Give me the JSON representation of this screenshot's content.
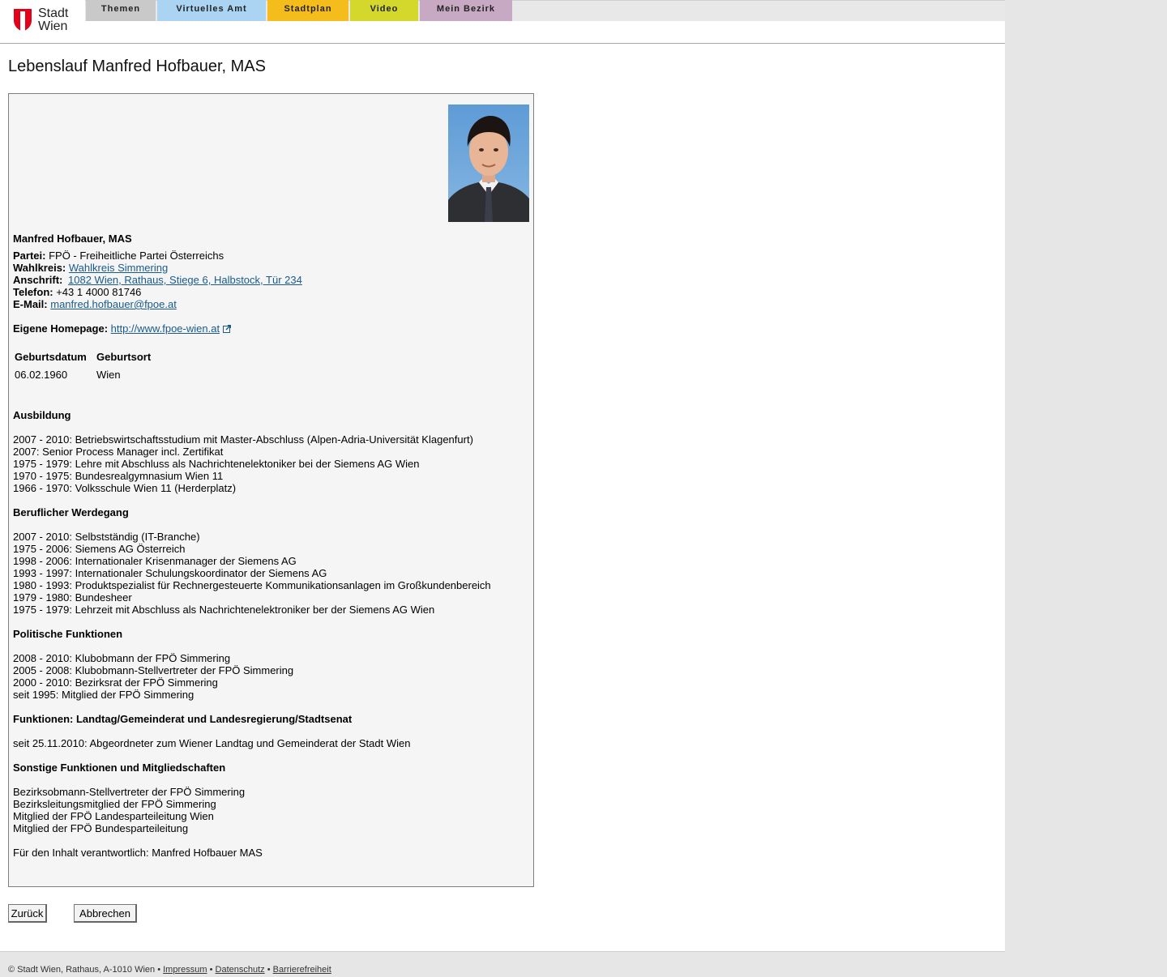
{
  "header": {
    "logo_text": "Stadt\nWien",
    "nav": [
      {
        "label": "Themen",
        "color": "#c9c9c9"
      },
      {
        "label": "Virtuelles Amt",
        "color": "#aad4f2"
      },
      {
        "label": "Stadtplan",
        "color": "#f5bd1c"
      },
      {
        "label": "Video",
        "color": "#d4d82c"
      },
      {
        "label": "Mein Bezirk",
        "color": "#c8a9c4"
      }
    ]
  },
  "page_title": "Lebenslauf Manfred Hofbauer, MAS",
  "profile": {
    "name": "Manfred Hofbauer, MAS",
    "partei_label": "Partei:",
    "partei": "FPÖ - Freiheitliche Partei Österreichs",
    "wahlkreis_label": "Wahlkreis:",
    "wahlkreis": "Wahlkreis Simmering",
    "anschrift_label": "Anschrift:",
    "anschrift": "1082 Wien, Rathaus, Stiege 6, Halbstock, Tür 234",
    "telefon_label": "Telefon:",
    "telefon": "+43 1 4000 81746",
    "email_label": "E-Mail:",
    "email": "manfred.hofbauer@fpoe.at",
    "homepage_label": "Eigene Homepage:",
    "homepage": "http://www.fpoe-wien.at",
    "table": {
      "headers": [
        "Geburtsdatum",
        "Geburtsort"
      ],
      "values": [
        "06.02.1960",
        "Wien"
      ]
    }
  },
  "sections": [
    {
      "heading": "Ausbildung",
      "lines": [
        "2007 - 2010: Betriebswirtschaftsstudium mit Master-Abschluss (Alpen-Adria-Universität Klagenfurt)",
        "2007: Senior Process Manager incl. Zertifikat",
        "1975 - 1979: Lehre mit Abschluss als Nachrichtenelektoniker bei der Siemens AG Wien",
        "1970 - 1975: Bundesrealgymnasium Wien 11",
        "1966 - 1970: Volksschule Wien 11 (Herderplatz)"
      ]
    },
    {
      "heading": "Beruflicher Werdegang",
      "lines": [
        "2007 - 2010: Selbstständig (IT-Branche)",
        "1975 - 2006: Siemens AG Österreich",
        "1998 - 2006: Internationaler Krisenmanager der Siemens AG",
        "1993 - 1997: Internationaler Schulungskoordinator der Siemens AG",
        "1980 - 1993: Produktspezialist für Rechnergesteuerte Kommunikationsanlagen im Großkundenbereich",
        "1979 - 1980: Bundesheer",
        "1975 - 1979: Lehrzeit mit Abschluss als Nachrichtenelektroniker ber der Siemens AG Wien"
      ]
    },
    {
      "heading": "Politische Funktionen",
      "lines": [
        "2008 - 2010: Klubobmann der FPÖ Simmering",
        "2005 - 2008: Klubobmann-Stellvertreter der FPÖ Simmering",
        "2000 - 2010: Bezirksrat der FPÖ Simmering",
        "seit 1995: Mitglied der FPÖ Simmering"
      ]
    },
    {
      "heading": "Funktionen: Landtag/Gemeinderat und Landesregierung/Stadtsenat",
      "lines": [
        "seit 25.11.2010: Abgeordneter zum Wiener Landtag und Gemeinderat der Stadt Wien"
      ]
    },
    {
      "heading": "Sonstige Funktionen und Mitgliedschaften",
      "lines": [
        "Bezirksobmann-Stellvertreter der FPÖ Simmering",
        "Bezirksleitungsmitglied der FPÖ Simmering",
        "Mitglied der FPÖ Landesparteileitung Wien",
        "Mitglied der FPÖ Bundesparteileitung"
      ]
    }
  ],
  "responsible": "Für den Inhalt verantwortlich: Manfred Hofbauer MAS",
  "buttons": {
    "back": "Zurück",
    "cancel": "Abbrechen"
  },
  "footer": {
    "copyright": "© Stadt Wien, Rathaus, A-1010 Wien",
    "sep": "•",
    "links": [
      "Impressum",
      "Datenschutz",
      "Barrierefreiheit"
    ]
  }
}
